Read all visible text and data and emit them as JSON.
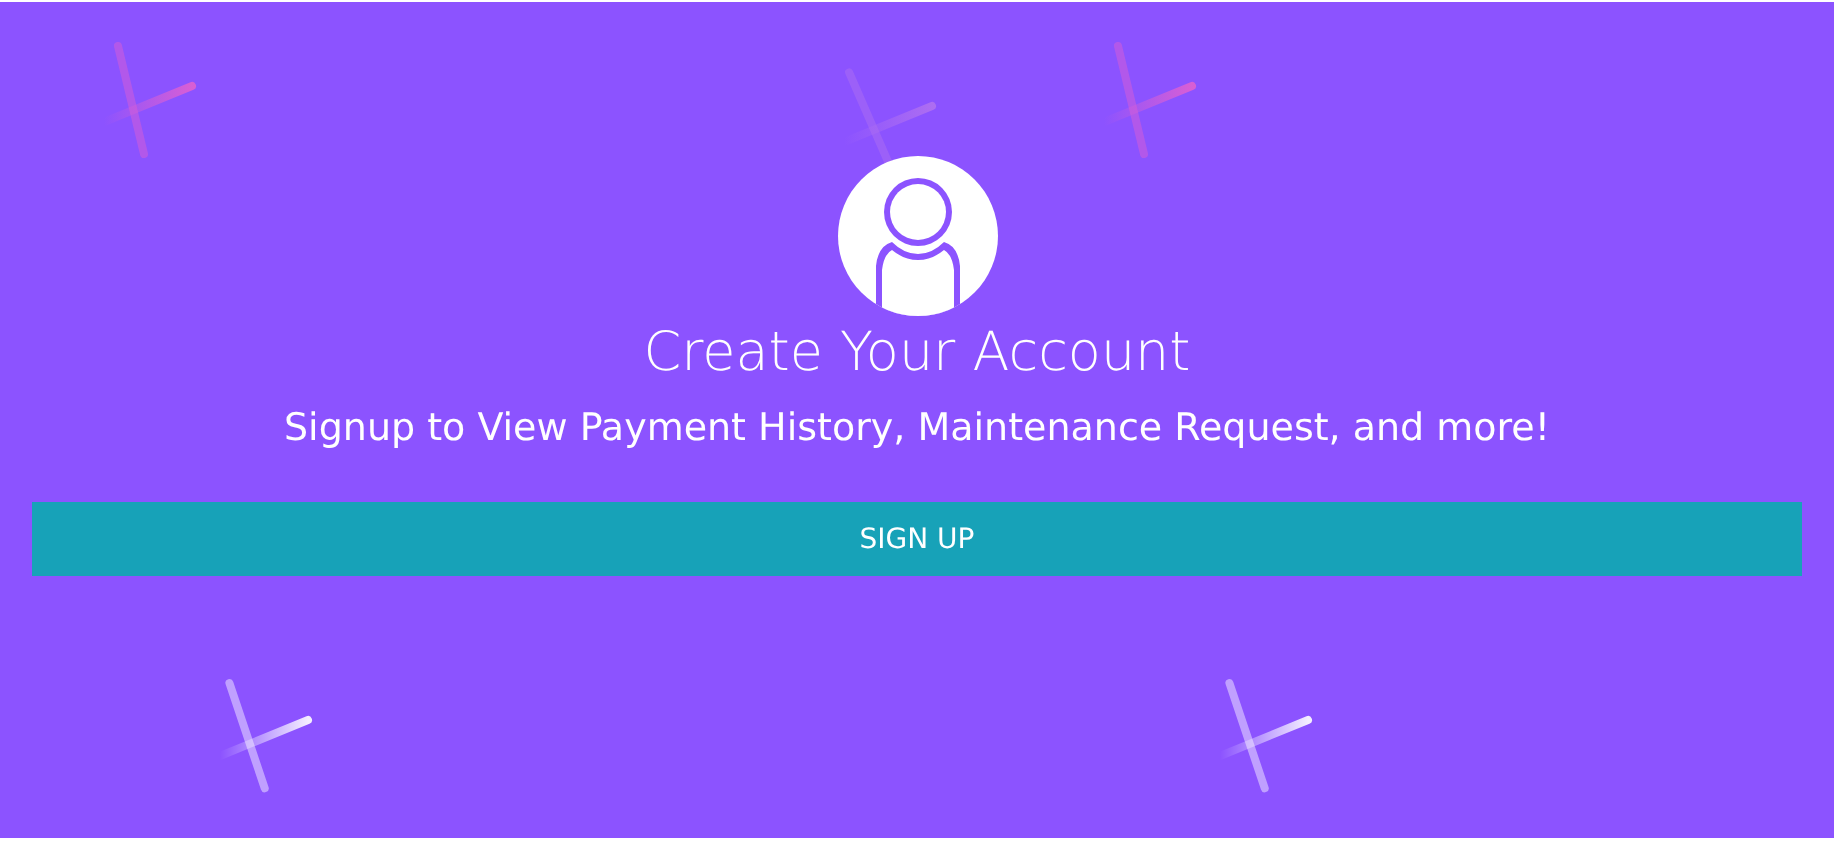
{
  "title": "Create Your Account",
  "subtitle": "Signup to View Payment History, Maintenance Request, and more!",
  "button": "SIGN UP"
}
